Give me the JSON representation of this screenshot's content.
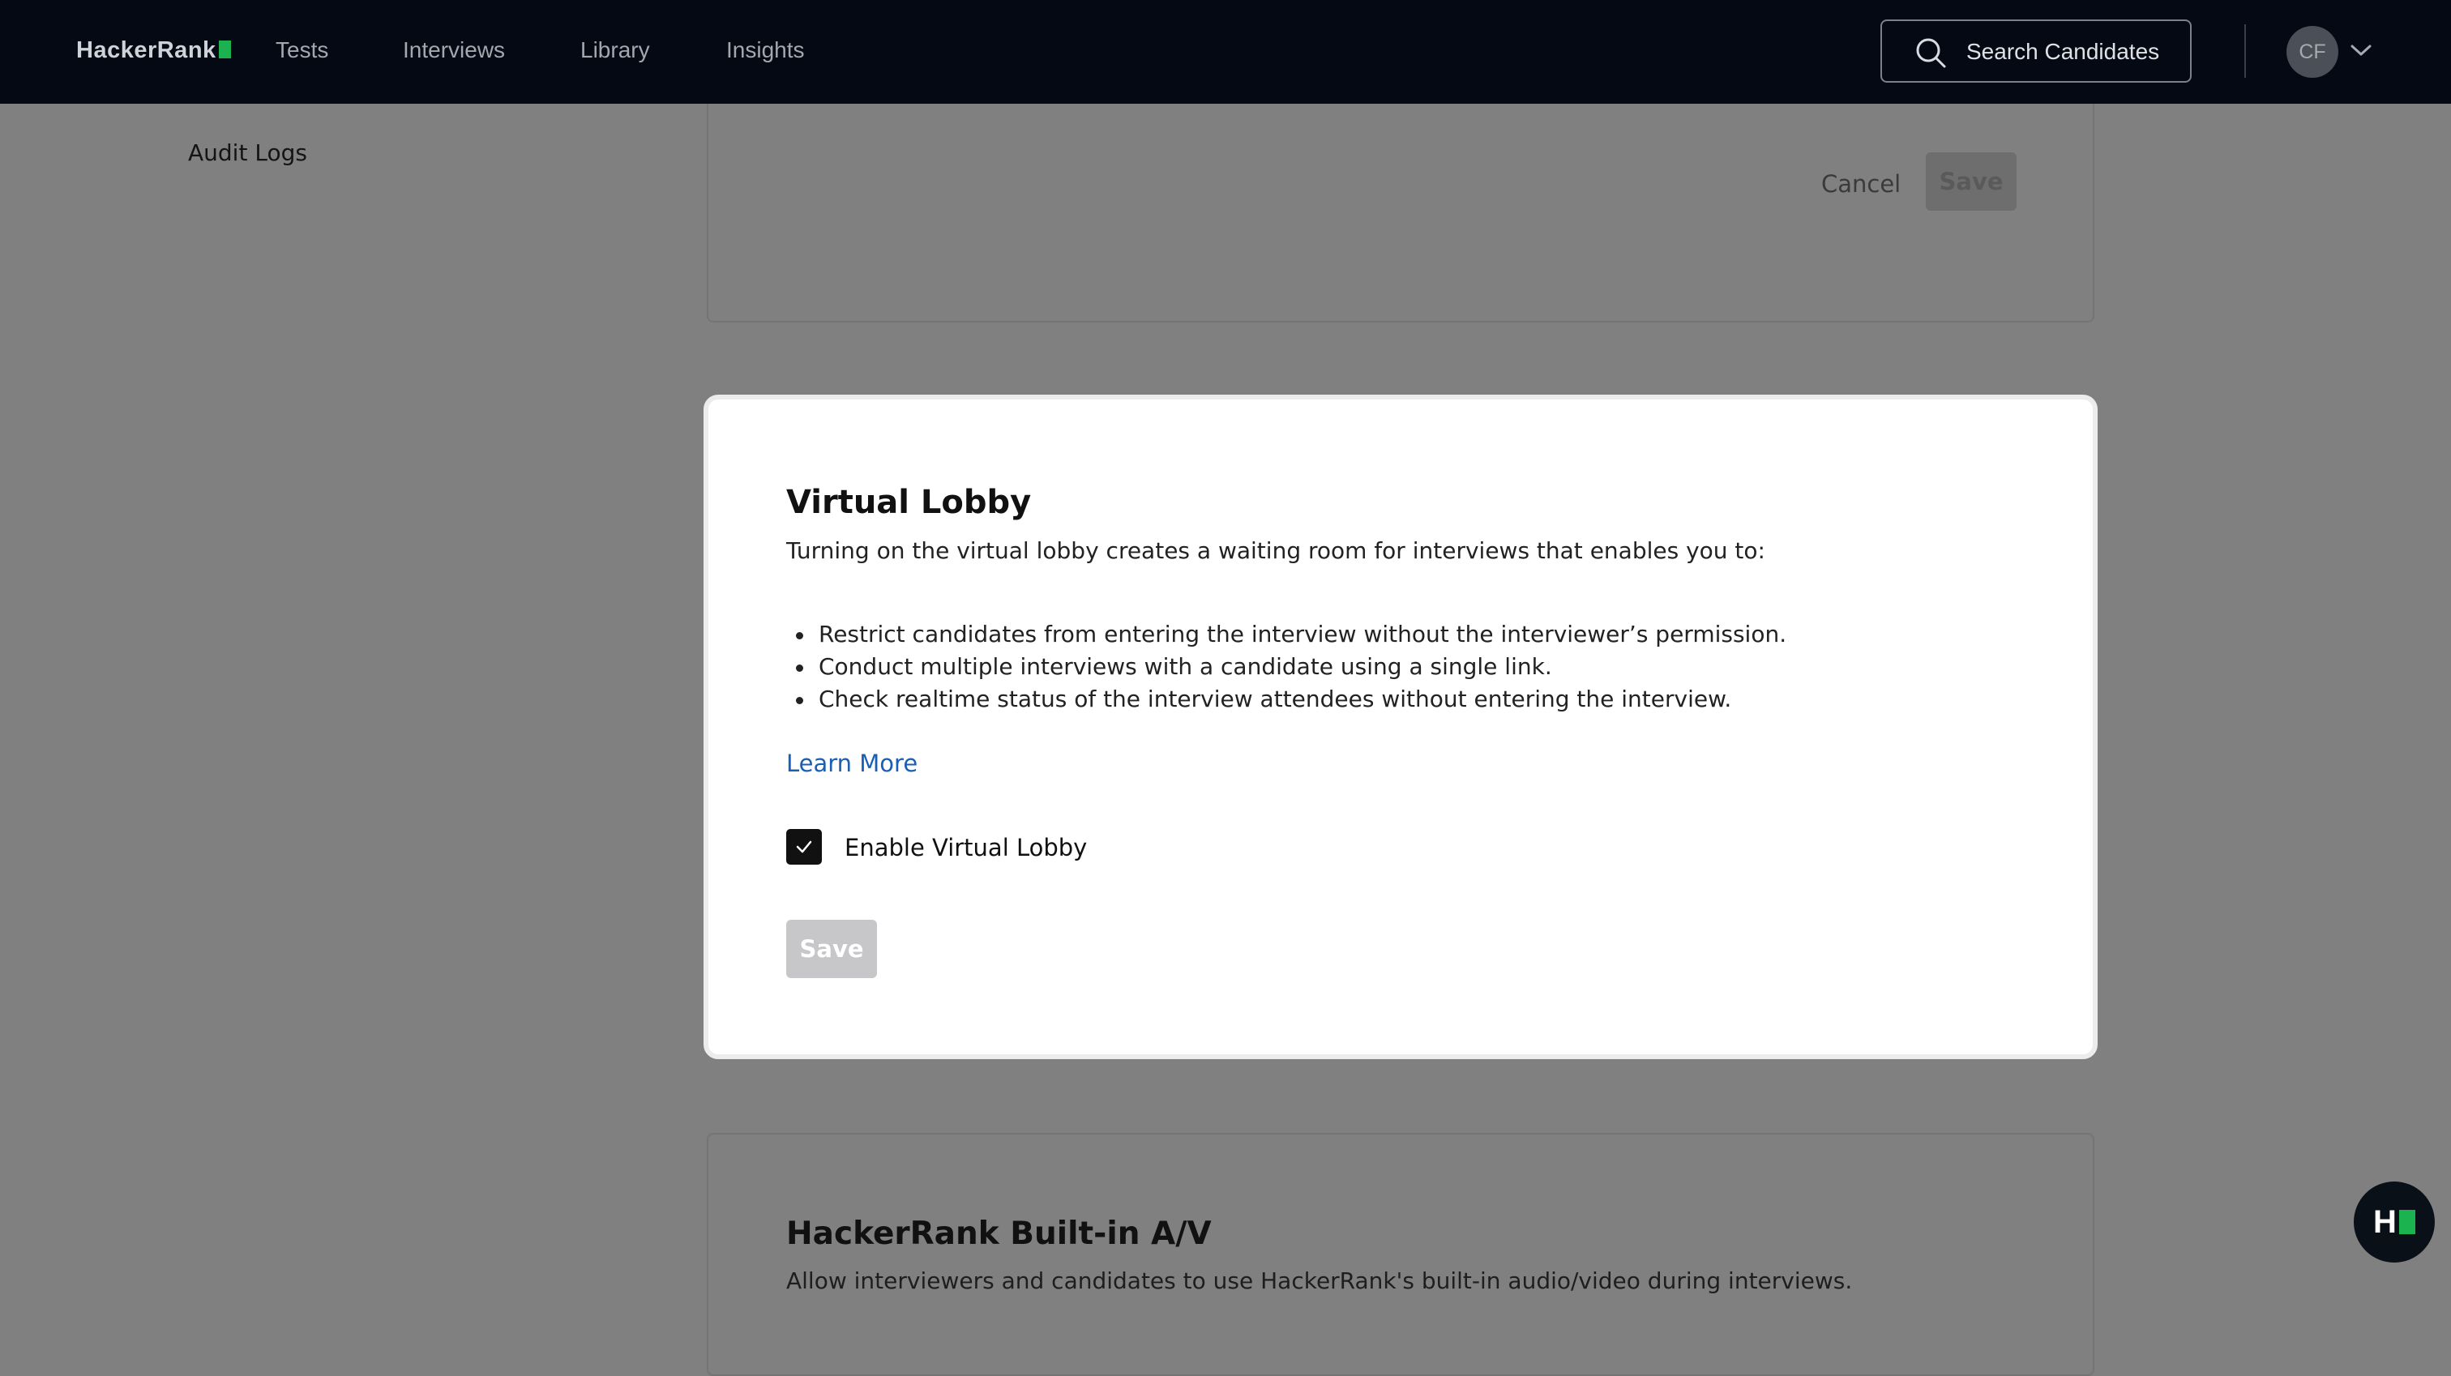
{
  "topnav": {
    "logo": "HackerRank",
    "items": [
      "Tests",
      "Interviews",
      "Library",
      "Insights"
    ],
    "search_label": "Search Candidates",
    "avatar_initials": "CF"
  },
  "sidebar": {
    "audit_logs": "Audit Logs"
  },
  "background_card_top": {
    "cancel_label": "Cancel",
    "save_label": "Save"
  },
  "modal": {
    "title": "Virtual Lobby",
    "description": "Turning on the virtual lobby creates a waiting room for interviews that enables you to:",
    "bullets": [
      "Restrict candidates from entering the interview without the interviewer’s permission.",
      "Conduct multiple interviews with a candidate using a single link.",
      "Check realtime status of the interview attendees without entering the interview."
    ],
    "learn_more": "Learn More",
    "checkbox_label": "Enable Virtual Lobby",
    "checkbox_checked": true,
    "save_label": "Save"
  },
  "background_card_bottom": {
    "title": "HackerRank Built-in A/V",
    "description": "Allow interviewers and candidates to use HackerRank's built-in audio/video during interviews."
  },
  "help_fab": {
    "label": "H"
  },
  "colors": {
    "nav_bg": "#050913",
    "overlay": "#808080",
    "brand_green": "#1bb34f",
    "link_blue": "#1a5fb4",
    "disabled_button": "#c7c7c9"
  }
}
